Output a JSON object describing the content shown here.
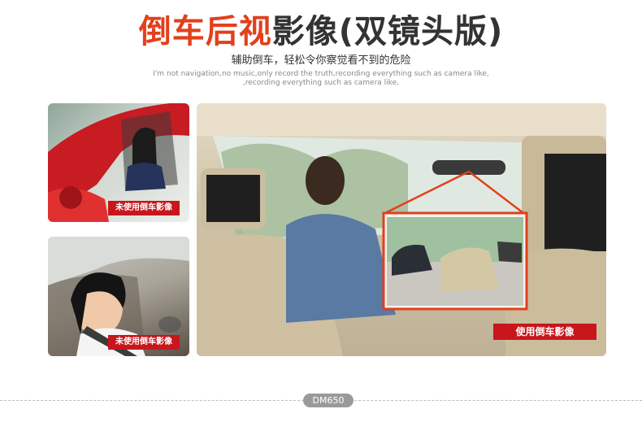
{
  "header": {
    "title_red": "倒车后视",
    "title_dark": "影像(双镜头版)",
    "subtitle": "辅助倒车，轻松令你察觉看不到的危险",
    "english_line1": "I'm not navigation,no music,only record the truth,recording everything such as camera like,",
    "english_line2": ",recording everything such as camera like,"
  },
  "panels": [
    {
      "label": "未使用倒车影像",
      "icon": "car-driver-woman-photo"
    },
    {
      "label": "未使用倒车影像",
      "icon": "smiling-woman-driver-photo"
    },
    {
      "label": "使用倒车影像",
      "icon": "car-interior-rear-view-photo"
    }
  ],
  "footer": {
    "model": "DM650"
  },
  "colors": {
    "accent_red": "#e2401c",
    "label_red": "#c8161d",
    "dark_text": "#333333"
  }
}
